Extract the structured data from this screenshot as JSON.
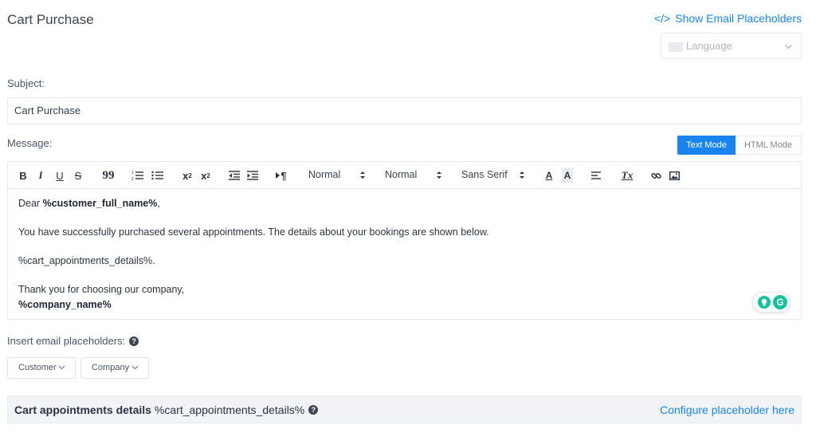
{
  "header": {
    "title": "Cart Purchase",
    "show_placeholders_icon": "</>",
    "show_placeholders_label": "Show Email Placeholders"
  },
  "language": {
    "placeholder": "Language",
    "icon": "chevron-down-icon"
  },
  "subject": {
    "label": "Subject:",
    "value": "Cart Purchase"
  },
  "message": {
    "label": "Message:",
    "modes": {
      "text": "Text Mode",
      "html": "HTML Mode",
      "active": "text"
    }
  },
  "toolbar": {
    "bold": "B",
    "italic": "I",
    "underline": "U",
    "strike": "S",
    "quote": "99",
    "header_size": {
      "value": "Normal"
    },
    "font_size": {
      "value": "Normal"
    },
    "font_family": {
      "value": "Sans Serif"
    },
    "text_color": "A",
    "background_color": "A",
    "clear_format": "Tx",
    "subscript": "x",
    "subscript_mark": "2",
    "superscript": "x",
    "superscript_mark": "2",
    "ltr_mark": "¶"
  },
  "body": {
    "greeting_prefix": "Dear ",
    "greeting_placeholder": "%customer_full_name%",
    "greeting_suffix": ",",
    "line2": "You have successfully purchased several appointments. The details about your bookings are shown below.",
    "line3": "%cart_appointments_details%.",
    "line4": "Thank you for choosing our company,",
    "line5": "%company_name%"
  },
  "grammarly": {
    "logo": "G"
  },
  "insert": {
    "label": "Insert email placeholders:",
    "help": "?",
    "buttons": [
      "Customer",
      "Company"
    ]
  },
  "details": {
    "title": "Cart appointments details",
    "placeholder": "%cart_appointments_details%",
    "help": "?",
    "link": "Configure placeholder here"
  },
  "colors": {
    "accent": "#1a84ee",
    "grammarly": "#15c39a",
    "bar_bg": "#f1f3f6"
  }
}
